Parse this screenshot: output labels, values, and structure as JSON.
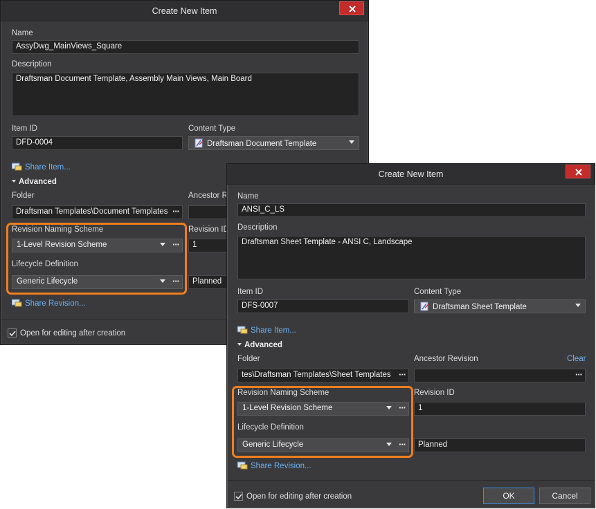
{
  "dialog1": {
    "title": "Create New Item",
    "name_label": "Name",
    "name_value": "AssyDwg_MainViews_Square",
    "description_label": "Description",
    "description_value": "Draftsman Document Template, Assembly Main Views, Main Board",
    "item_id_label": "Item ID",
    "item_id_value": "DFD-0004",
    "content_type_label": "Content Type",
    "content_type_value": "Draftsman Document Template",
    "share_item_link": "Share Item...",
    "advanced_label": "Advanced",
    "folder_label": "Folder",
    "folder_value": "Draftsman Templates\\Document Templates",
    "ancestor_label": "Ancestor R",
    "revision_naming_label": "Revision Naming Scheme",
    "revision_naming_value": "1-Level Revision Scheme",
    "revision_id_label": "Revision ID",
    "revision_id_value": "1",
    "lifecycle_label": "Lifecycle Definition",
    "lifecycle_value": "Generic Lifecycle",
    "lifecycle_state_value": "Planned",
    "share_revision_link": "Share Revision...",
    "open_after_label": "Open for editing after creation",
    "open_after_checked": true
  },
  "dialog2": {
    "title": "Create New Item",
    "name_label": "Name",
    "name_value": "ANSI_C_LS",
    "description_label": "Description",
    "description_value": "Draftsman Sheet Template - ANSI C, Landscape",
    "item_id_label": "Item ID",
    "item_id_value": "DFS-0007",
    "content_type_label": "Content Type",
    "content_type_value": "Draftsman Sheet Template",
    "share_item_link": "Share Item...",
    "advanced_label": "Advanced",
    "folder_label": "Folder",
    "folder_value": "tes\\Draftsman Templates\\Sheet Templates",
    "ancestor_label": "Ancestor Revision",
    "clear_link": "Clear",
    "revision_naming_label": "Revision Naming Scheme",
    "revision_naming_value": "1-Level Revision Scheme",
    "revision_id_label": "Revision ID",
    "revision_id_value": "1",
    "lifecycle_label": "Lifecycle Definition",
    "lifecycle_value": "Generic Lifecycle",
    "lifecycle_state_value": "Planned",
    "share_revision_link": "Share Revision...",
    "open_after_label": "Open for editing after creation",
    "open_after_checked": true,
    "ok_label": "OK",
    "cancel_label": "Cancel"
  },
  "colors": {
    "dialog_bg": "#3a3a3c",
    "highlight": "#f07e1e",
    "close_button": "#c42b2b",
    "link": "#6ab0f0",
    "ok_border": "#3b8ee5"
  },
  "icons": {
    "close": "close-icon",
    "content_type": "draftsman-template-icon",
    "share": "share-icon",
    "dropdown": "chevron-down-icon",
    "more": "ellipsis-icon",
    "checkbox": "checkmark-icon"
  }
}
